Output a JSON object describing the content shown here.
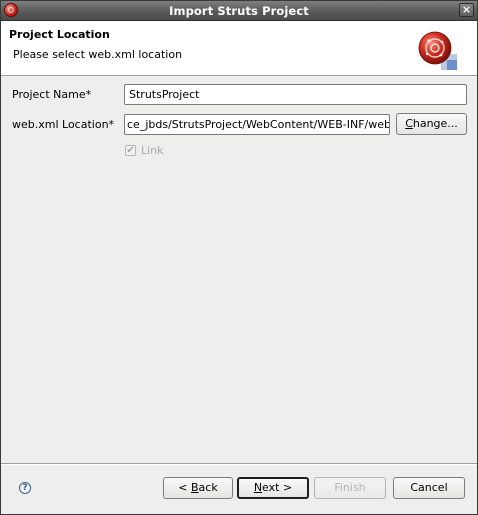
{
  "window": {
    "title": "Import Struts Project"
  },
  "header": {
    "title": "Project Location",
    "description": "Please select web.xml location"
  },
  "form": {
    "project_name_label": "Project Name*",
    "project_name_value": "StrutsProject",
    "webxml_label": "web.xml Location*",
    "webxml_value": "ce_jbds/StrutsProject/WebContent/WEB-INF/web.xml",
    "change_button": {
      "before": "",
      "mnemonic": "C",
      "after": "hange..."
    },
    "link_label": "Link",
    "link_checked": true
  },
  "footer": {
    "back_button": {
      "before": "< ",
      "mnemonic": "B",
      "after": "ack"
    },
    "next_button": {
      "before": "",
      "mnemonic": "N",
      "after": "ext >"
    },
    "finish_label": "Finish",
    "cancel_label": "Cancel"
  },
  "icons": {
    "app": "jboss-logo-icon",
    "close": "close-icon",
    "help": "help-icon",
    "wizard": "wizard-banner-icon",
    "check": "✔"
  },
  "colors": {
    "titlebar": "#5a5a5a",
    "header_bg": "#ffffff",
    "dialog_bg": "#eeeeec",
    "disabled_text": "#a8a8a6"
  }
}
